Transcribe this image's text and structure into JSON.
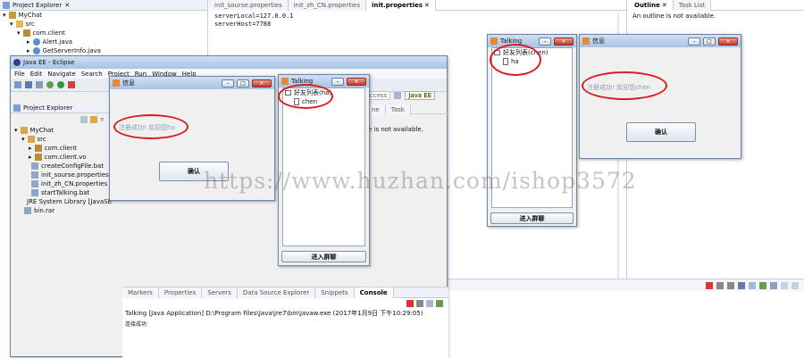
{
  "back_window": {
    "project_explorer_title": "Project Explorer",
    "tree": [
      "MyChat",
      "src",
      "com.client",
      "Alert.java",
      "GetServerInfo.java"
    ],
    "editor_tabs": [
      "init_sourse.properties",
      "init_zh_CN.properties",
      "init.properties"
    ],
    "editor_lines": [
      "serverLocal=127.0.0.1",
      "serverHost=7788"
    ],
    "outline_tab": "Outline",
    "tasklist_tab": "Task List",
    "outline_message": "An outline is not available."
  },
  "eclipse_window": {
    "title": "Java EE - Eclipse",
    "menu": [
      "File",
      "Edit",
      "Navigate",
      "Search",
      "Project",
      "Run",
      "Window",
      "Help"
    ],
    "quick_access": "ccess",
    "perspective": "Java EE",
    "project_explorer_title": "Project Explorer",
    "tree": [
      {
        "label": "MyChat",
        "level": 0
      },
      {
        "label": "src",
        "level": 1
      },
      {
        "label": "com.client",
        "level": 2
      },
      {
        "label": "com.client.vo",
        "level": 2
      },
      {
        "label": "createConfigFile.bat",
        "level": 2
      },
      {
        "label": "init_sourse.properties",
        "level": 2
      },
      {
        "label": "init_zh_CN.properties",
        "level": 2
      },
      {
        "label": "startTalking.bat",
        "level": 2
      },
      {
        "label": "JRE System Library [JavaSE",
        "level": 1
      },
      {
        "label": "bin.rar",
        "level": 1
      }
    ],
    "right_tabs": [
      "ne",
      "Task"
    ],
    "outline_msg": "e is not available.",
    "bottom_tabs": [
      "Markers",
      "Properties",
      "Servers",
      "Data Source Explorer",
      "Snippets",
      "Console"
    ],
    "console_header": "Talking [Java Application] D:\\Program Files\\Java\\jre7\\bin\\javaw.exe (2017年1月9日 下午10:29:05)",
    "console_output": "连接成功"
  },
  "info_dialog_1": {
    "title": "信息",
    "message": "注册成功! 欢迎您ha",
    "button": "确认"
  },
  "talking_1": {
    "title": "Talking",
    "root": "好友列表(ha)",
    "friend": "chen",
    "button": "进入群聊"
  },
  "talking_2": {
    "title": "Talking",
    "root": "好友列表(chen)",
    "friend": "ha",
    "button": "进入群聊"
  },
  "info_dialog_2": {
    "title": "信息",
    "message": "注册成功! 欢迎您chen",
    "button": "确认"
  },
  "watermark": "https://www.huzhan.com/ishop3572",
  "colors": {
    "highlight": "#d81e1e",
    "title_bar": "#a9c4e4",
    "message_text": "#8a9bb0"
  }
}
